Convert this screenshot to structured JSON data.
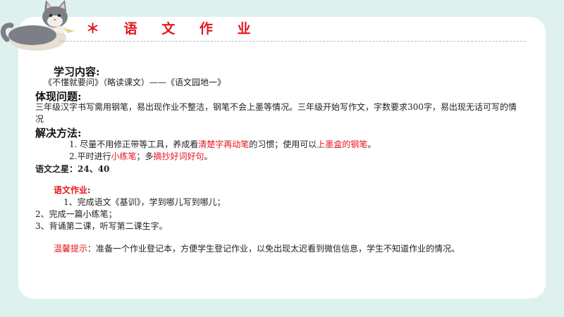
{
  "title": "＊ 语 文 作 业",
  "sections": {
    "content_heading": "学习内容:",
    "content_text": "《不懂就要问》（略读课文）——《语文园地一》",
    "problem_heading": "体现问题:",
    "problem_text": "三年级汉字书写需用钢笔，易出现作业不整洁，钢笔不会上墨等情况。三年级开始写作文，字数要求300字，易出现无话可写的情况",
    "solution_heading": "解决方法:",
    "solution_1_pre": "1. 尽量不用修正带等工具，养成看",
    "solution_1_red1": "清楚字再动笔",
    "solution_1_mid": "的习惯；使用可以",
    "solution_1_red2": "上墨盒的钢笔",
    "solution_1_post": "。",
    "solution_2_pre": "2.平时进行",
    "solution_2_red1": "小练笔",
    "solution_2_mid": "；多",
    "solution_2_red2": "摘抄好词好句",
    "solution_2_post": "。",
    "star_label": "语文之星：24、40",
    "homework_heading": "语文作业",
    "homework_colon": ":",
    "homework_1": "1、完成语文《基训》，学到哪儿写到哪儿；",
    "homework_2": "2、完成一篇小练笔；",
    "homework_3": "3、背诵第二课，听写第二课生字。",
    "tip_label": "温馨提示",
    "tip_text": "：准备一个作业登记本，方便学生登记作业，以免出现太迟看到微信信息，学生不知道作业的情况。"
  },
  "colors": {
    "accent": "#e4151c",
    "background": "#dff1ef"
  },
  "icons": {
    "mascot": "cat-icon"
  }
}
